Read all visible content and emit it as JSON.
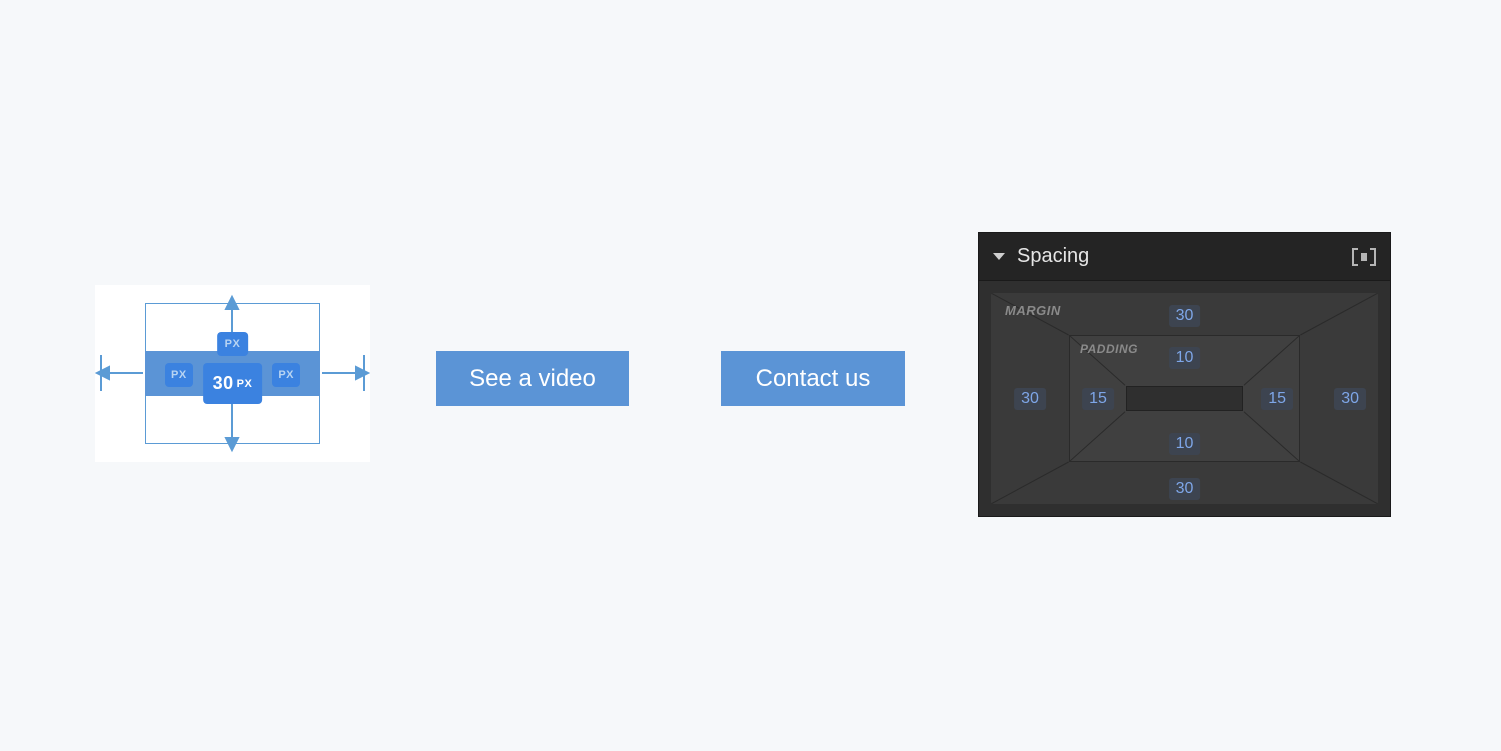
{
  "canvas": {
    "selected_button": {
      "margin_value": "30",
      "margin_unit": "PX",
      "badge_top_unit": "PX",
      "badge_left_unit": "PX",
      "badge_right_unit": "PX"
    },
    "buttons": [
      {
        "label": "See a video"
      },
      {
        "label": "Contact us"
      }
    ]
  },
  "panel": {
    "title": "Spacing",
    "margin_label": "MARGIN",
    "padding_label": "PADDING",
    "margin": {
      "top": "30",
      "right": "30",
      "bottom": "30",
      "left": "30"
    },
    "padding": {
      "top": "10",
      "right": "15",
      "bottom": "10",
      "left": "15"
    }
  }
}
